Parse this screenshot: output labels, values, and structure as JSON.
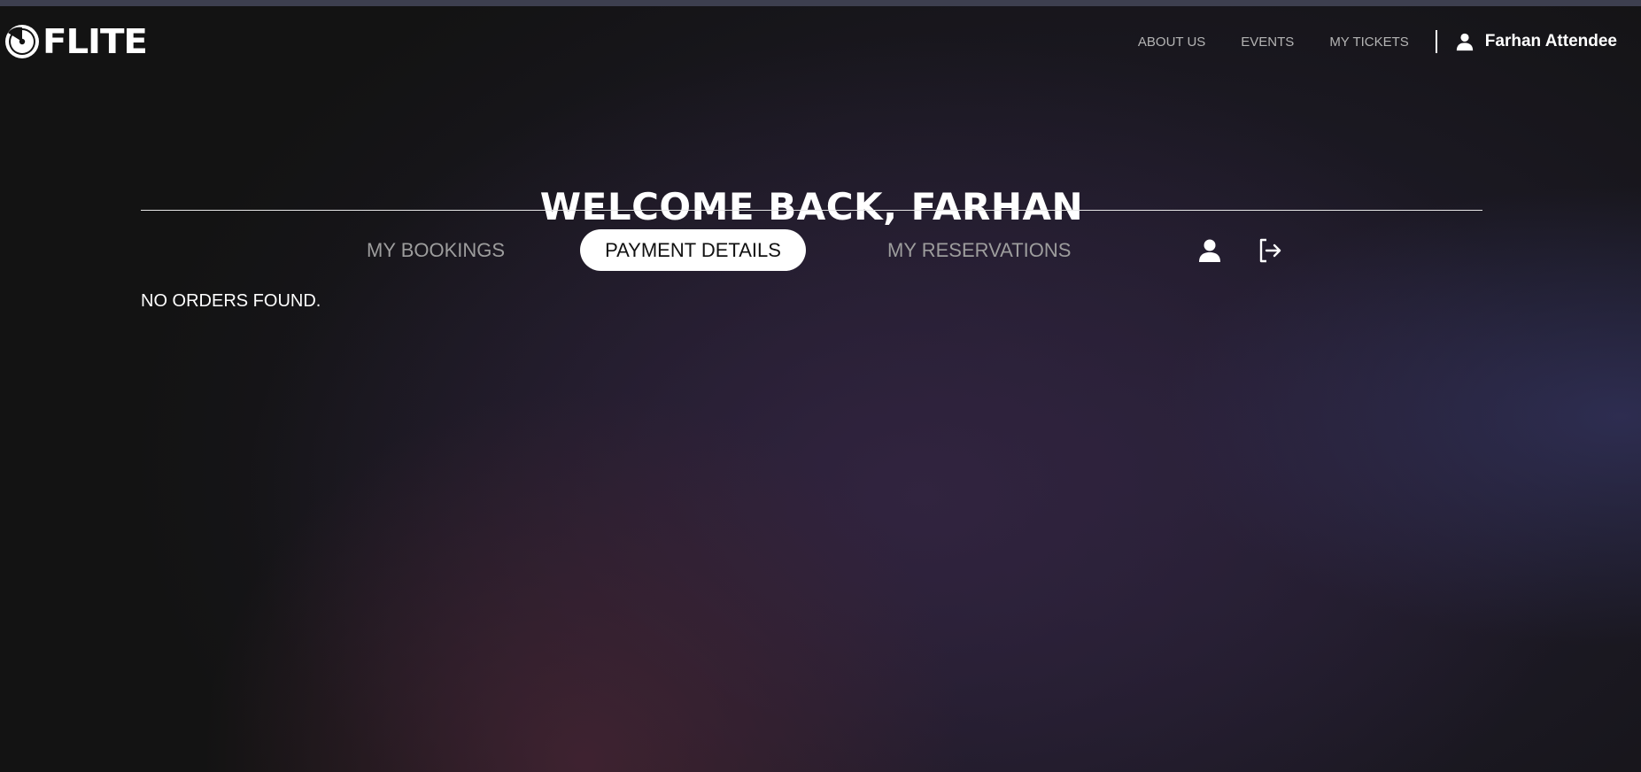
{
  "app": {
    "logo_text": "FLITE"
  },
  "nav": {
    "links": [
      "ABOUT US",
      "EVENTS",
      "MY TICKETS"
    ],
    "user_name": "Farhan Attendee"
  },
  "main": {
    "welcome": "WELCOME BACK, FARHAN",
    "tabs": [
      {
        "label": "MY BOOKINGS",
        "active": false
      },
      {
        "label": "PAYMENT DETAILS",
        "active": true
      },
      {
        "label": "MY RESERVATIONS",
        "active": false
      }
    ],
    "empty_message": "NO ORDERS FOUND."
  },
  "colors": {
    "background": "#131313",
    "text": "#ffffff",
    "muted_text": "#9d9d9d",
    "active_tab_bg": "#ffffff"
  },
  "icons": [
    "logo-icon",
    "user-icon",
    "profile-icon",
    "logout-icon"
  ]
}
